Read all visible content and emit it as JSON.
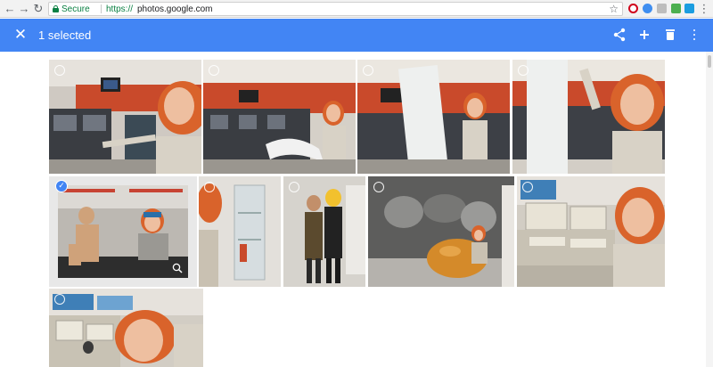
{
  "browser": {
    "back_icon": "←",
    "forward_icon": "→",
    "reload_icon": "↻",
    "secure_label": "Secure",
    "url_scheme": "https://",
    "url_host": "photos.google.com",
    "bookmark_icon": "☆",
    "menu_icon": "⋮"
  },
  "appbar": {
    "close_icon": "✕",
    "title": "1 selected",
    "color": "#4285f4"
  },
  "photos": {
    "selected_count": 1,
    "check_glyph": "✓"
  },
  "colors": {
    "accent": "#4285f4",
    "secure_green": "#0b8043"
  }
}
